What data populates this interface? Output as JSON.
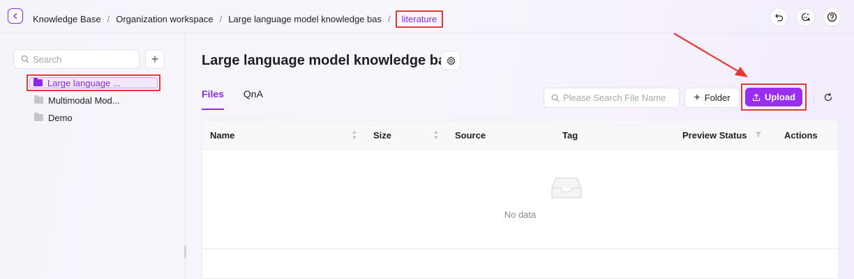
{
  "breadcrumb": {
    "items": [
      "Knowledge Base",
      "Organization workspace",
      "Large language model knowledge bas"
    ],
    "current": "literature",
    "separator": "/"
  },
  "sidebar": {
    "search_placeholder": "Search",
    "add_label": "+",
    "items": [
      {
        "label": "Large language ...",
        "active": true
      },
      {
        "label": "Multimodal Mod..."
      },
      {
        "label": "Demo"
      }
    ]
  },
  "main": {
    "title": "Large language model knowledge bas",
    "tabs": [
      {
        "label": "Files",
        "active": true
      },
      {
        "label": "QnA"
      }
    ],
    "file_search_placeholder": "Please Search File Name",
    "folder_button": "Folder",
    "folder_plus": "+",
    "upload_button": "Upload"
  },
  "table": {
    "columns": [
      "Name",
      "Size",
      "Source",
      "Tag",
      "Preview Status",
      "Actions"
    ],
    "empty_text": "No data"
  },
  "colors": {
    "accent": "#8a2be2",
    "upload": "#9a2ef0",
    "annotation": "#e53935"
  },
  "icons": [
    "chevron-left-icon",
    "undo-icon",
    "sparkle-chat-icon",
    "help-icon",
    "search-icon",
    "plus-icon",
    "folder-icon",
    "gear-icon",
    "upload-icon",
    "refresh-icon",
    "sort-icon",
    "filter-icon",
    "inbox-icon"
  ]
}
